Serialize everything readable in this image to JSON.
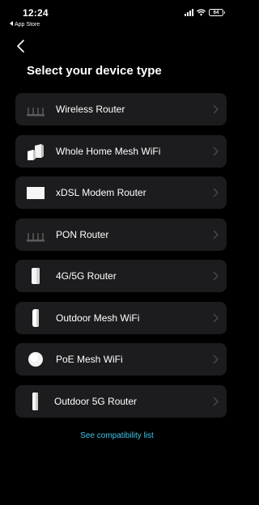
{
  "status_bar": {
    "time": "12:24",
    "back_app": "App Store",
    "battery_level": "64"
  },
  "nav": {
    "back_icon": "chevron-left-icon"
  },
  "page_title": "Select your device type",
  "devices": [
    {
      "label": "Wireless Router",
      "icon": "wireless-router-icon"
    },
    {
      "label": "Whole Home Mesh WiFi",
      "icon": "mesh-wifi-icon"
    },
    {
      "label": "xDSL Modem Router",
      "icon": "xdsl-modem-icon"
    },
    {
      "label": "PON Router",
      "icon": "pon-router-icon"
    },
    {
      "label": "4G/5G Router",
      "icon": "cellular-router-icon"
    },
    {
      "label": "Outdoor Mesh WiFi",
      "icon": "outdoor-mesh-icon"
    },
    {
      "label": "PoE Mesh WiFi",
      "icon": "poe-mesh-icon"
    },
    {
      "label": "Outdoor 5G Router",
      "icon": "outdoor-5g-router-icon"
    }
  ],
  "compatibility_link": "See compatibility list",
  "colors": {
    "background": "#000000",
    "card": "#1c1c1e",
    "link": "#3fc3e8"
  }
}
